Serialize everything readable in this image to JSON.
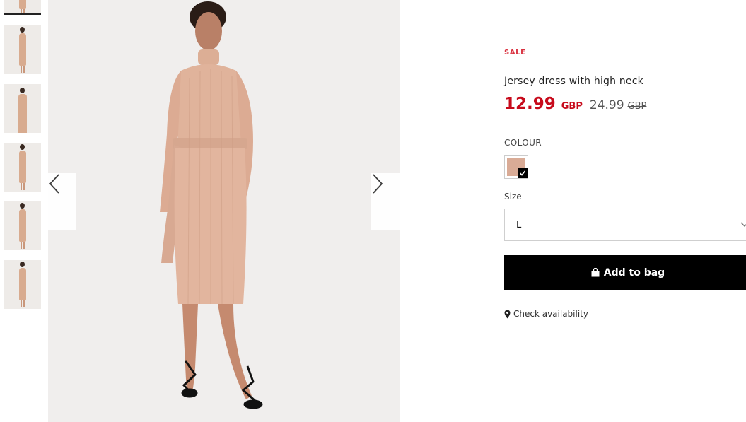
{
  "thumbnails": [
    {
      "label": "thumbnail-1",
      "active": true
    },
    {
      "label": "thumbnail-2"
    },
    {
      "label": "thumbnail-3"
    },
    {
      "label": "thumbnail-4"
    },
    {
      "label": "thumbnail-5"
    },
    {
      "label": "thumbnail-6"
    }
  ],
  "gallery": {
    "prev_icon": "chevron-left-icon",
    "next_icon": "chevron-right-icon"
  },
  "product": {
    "badge": "SALE",
    "title": "Jersey dress with high neck",
    "price_now": "12.99",
    "currency_now": "GBP",
    "price_old": "24.99",
    "currency_old": "GBP"
  },
  "colour": {
    "label": "COLOUR",
    "swatch_color": "#d9ab96",
    "selected": true
  },
  "size": {
    "label": "Size",
    "selected": "L"
  },
  "actions": {
    "add_to_bag": "Add to bag",
    "add_icon": "bag-icon",
    "check_availability": "Check availability",
    "availability_icon": "location-pin-icon"
  },
  "colors": {
    "sale": "#d9303e",
    "price": "#c70a1b",
    "button_bg": "#000000"
  }
}
